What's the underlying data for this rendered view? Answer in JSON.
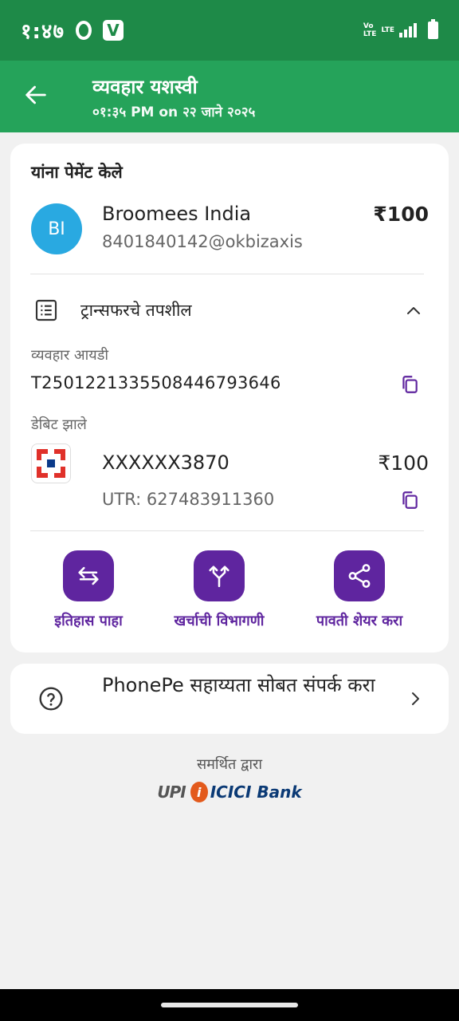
{
  "status_bar": {
    "time": "१:४७",
    "net_label_1": "Vo\nLTE",
    "net_label_2": "LTE"
  },
  "header": {
    "title": "व्यवहार यशस्वी",
    "subtitle": "०१:३५ PM on २२ जाने २०२५"
  },
  "payment": {
    "paid_to_label": "यांना पेमेंट केले",
    "avatar_initials": "BI",
    "payee_name": "Broomees India",
    "payee_upi": "8401840142@okbizaxis",
    "amount": "₹100"
  },
  "details": {
    "title": "ट्रान्सफरचे तपशील",
    "txn_id_label": "व्यवहार आयडी",
    "txn_id": "T2501221335508446793646",
    "debited_label": "डेबिट झाले",
    "account": "XXXXXX3870",
    "debit_amount": "₹100",
    "utr": "UTR: 627483911360"
  },
  "actions": [
    {
      "label": "इतिहास पाहा"
    },
    {
      "label": "खर्चाची विभागणी"
    },
    {
      "label": "पावती शेयर करा"
    }
  ],
  "help": {
    "text": "PhonePe सहाय्यता सोबत संपर्क करा"
  },
  "footer": {
    "powered_by": "समर्थित द्वारा",
    "upi": "UPI",
    "bank": "ICICI Bank"
  },
  "colors": {
    "status_green": "#1e8a48",
    "header_green": "#25a35a",
    "accent_purple": "#5f259f",
    "avatar_blue": "#29a9e1"
  }
}
